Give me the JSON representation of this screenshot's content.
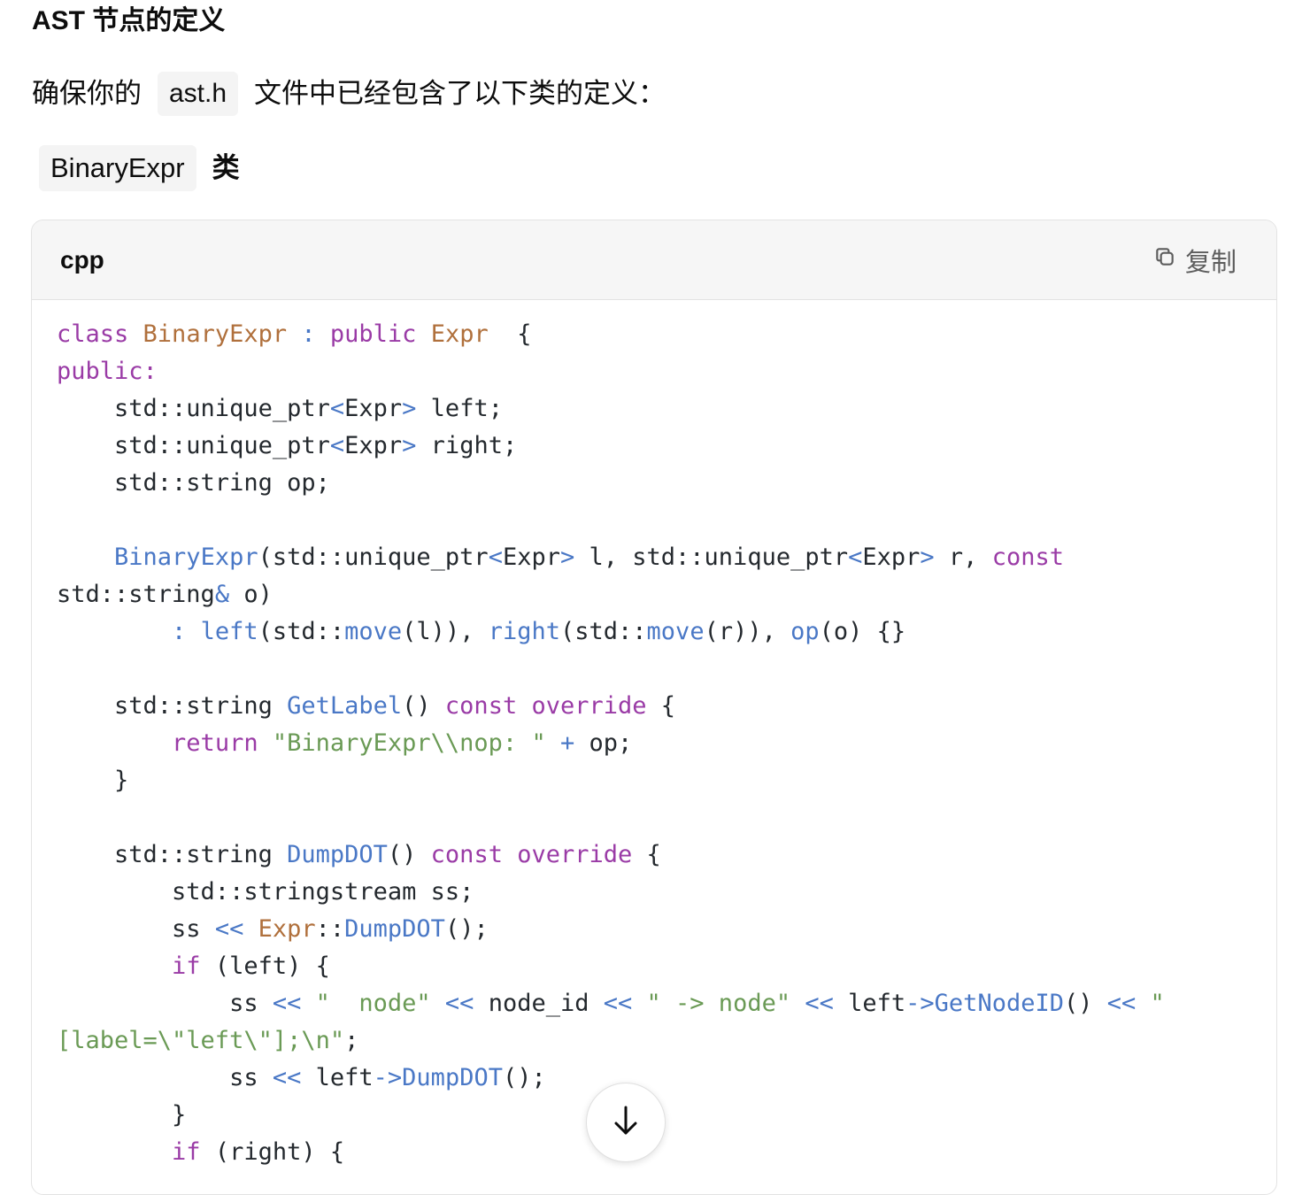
{
  "heading": "AST 节点的定义",
  "intro": {
    "before": "确保你的",
    "file": "ast.h",
    "after": "文件中已经包含了以下类的定义："
  },
  "subheading": {
    "code": "BinaryExpr",
    "suffix": "类"
  },
  "codeblock": {
    "language": "cpp",
    "copy_label": "复制",
    "lines": [
      [
        [
          "kw",
          "class "
        ],
        [
          "ty",
          "BinaryExpr"
        ],
        [
          "op",
          " : "
        ],
        [
          "kw",
          "public "
        ],
        [
          "ty",
          "Expr"
        ],
        [
          "",
          "  {"
        ]
      ],
      [
        [
          "kw",
          "public:"
        ]
      ],
      [
        [
          "",
          "    std::unique_ptr"
        ],
        [
          "op",
          "<"
        ],
        [
          "",
          "Expr"
        ],
        [
          "op",
          ">"
        ],
        [
          "",
          " left;"
        ]
      ],
      [
        [
          "",
          "    std::unique_ptr"
        ],
        [
          "op",
          "<"
        ],
        [
          "",
          "Expr"
        ],
        [
          "op",
          ">"
        ],
        [
          "",
          " right;"
        ]
      ],
      [
        [
          "",
          "    std::string op;"
        ]
      ],
      [],
      [
        [
          "",
          "    "
        ],
        [
          "fn",
          "BinaryExpr"
        ],
        [
          "",
          "(std::unique_ptr"
        ],
        [
          "op",
          "<"
        ],
        [
          "",
          "Expr"
        ],
        [
          "op",
          ">"
        ],
        [
          "",
          " l, std::unique_ptr"
        ],
        [
          "op",
          "<"
        ],
        [
          "",
          "Expr"
        ],
        [
          "op",
          ">"
        ],
        [
          "",
          " r, "
        ],
        [
          "kw",
          "const"
        ]
      ],
      [
        [
          "",
          "std::string"
        ],
        [
          "op",
          "&"
        ],
        [
          "",
          " o)"
        ]
      ],
      [
        [
          "op",
          "        : "
        ],
        [
          "fn",
          "left"
        ],
        [
          "",
          "(std::"
        ],
        [
          "fn",
          "move"
        ],
        [
          "",
          "(l)), "
        ],
        [
          "fn",
          "right"
        ],
        [
          "",
          "(std::"
        ],
        [
          "fn",
          "move"
        ],
        [
          "",
          "(r)), "
        ],
        [
          "fn",
          "op"
        ],
        [
          "",
          "(o) {}"
        ]
      ],
      [],
      [
        [
          "",
          "    std::string "
        ],
        [
          "fn",
          "GetLabel"
        ],
        [
          "",
          "() "
        ],
        [
          "kw",
          "const override"
        ],
        [
          "",
          " {"
        ]
      ],
      [
        [
          "",
          "        "
        ],
        [
          "kw",
          "return "
        ],
        [
          "st",
          "\"BinaryExpr\\\\nop: \""
        ],
        [
          "op",
          " + "
        ],
        [
          "",
          "op;"
        ]
      ],
      [
        [
          "",
          "    }"
        ]
      ],
      [],
      [
        [
          "",
          "    std::string "
        ],
        [
          "fn",
          "DumpDOT"
        ],
        [
          "",
          "() "
        ],
        [
          "kw",
          "const override"
        ],
        [
          "",
          " {"
        ]
      ],
      [
        [
          "",
          "        std::stringstream ss;"
        ]
      ],
      [
        [
          "",
          "        ss "
        ],
        [
          "op",
          "<< "
        ],
        [
          "ty",
          "Expr"
        ],
        [
          "",
          "::"
        ],
        [
          "fn",
          "DumpDOT"
        ],
        [
          "",
          "();"
        ]
      ],
      [
        [
          "",
          "        "
        ],
        [
          "kw",
          "if"
        ],
        [
          "",
          " (left) {"
        ]
      ],
      [
        [
          "",
          "            ss "
        ],
        [
          "op",
          "<< "
        ],
        [
          "st",
          "\"  node\""
        ],
        [
          "op",
          " << "
        ],
        [
          "",
          "node_id "
        ],
        [
          "op",
          "<< "
        ],
        [
          "st",
          "\" -> node\""
        ],
        [
          "op",
          " << "
        ],
        [
          "",
          "left"
        ],
        [
          "op",
          "->"
        ],
        [
          "fn",
          "GetNodeID"
        ],
        [
          "",
          "() "
        ],
        [
          "op",
          "<< "
        ],
        [
          "st",
          "\""
        ]
      ],
      [
        [
          "st",
          "[label=\\\"left\\\"];\\n\""
        ],
        [
          "",
          ";"
        ]
      ],
      [
        [
          "",
          "            ss "
        ],
        [
          "op",
          "<< "
        ],
        [
          "",
          "left"
        ],
        [
          "op",
          "->"
        ],
        [
          "fn",
          "DumpDOT"
        ],
        [
          "",
          "();"
        ]
      ],
      [
        [
          "",
          "        }"
        ]
      ],
      [
        [
          "",
          "        "
        ],
        [
          "kw",
          "if"
        ],
        [
          "",
          " (right) {"
        ]
      ]
    ]
  },
  "scroll_button": "scroll-down-arrow-icon"
}
